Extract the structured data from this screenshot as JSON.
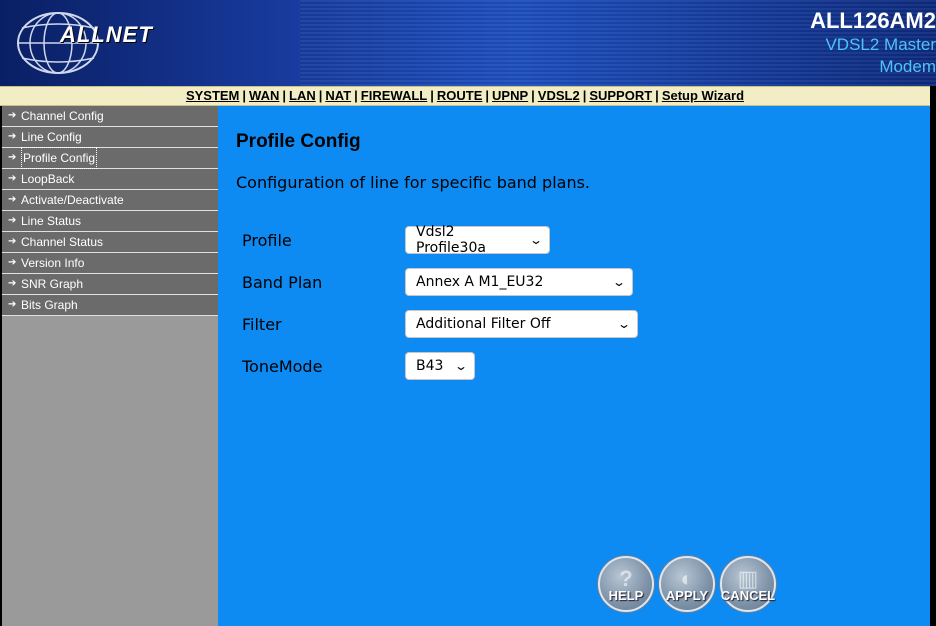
{
  "header": {
    "logo_text": "ALLNET",
    "model_name": "ALL126AM2",
    "model_sub_line1": "VDSL2 Master",
    "model_sub_line2": "Modem"
  },
  "nav": {
    "items": [
      "SYSTEM",
      "WAN",
      "LAN",
      "NAT",
      "FIREWALL",
      "ROUTE",
      "UPNP",
      "VDSL2",
      "SUPPORT",
      "Setup Wizard"
    ]
  },
  "sidebar": {
    "items": [
      {
        "label": "Channel Config"
      },
      {
        "label": "Line Config"
      },
      {
        "label": "Profile Config"
      },
      {
        "label": "LoopBack"
      },
      {
        "label": "Activate/Deactivate"
      },
      {
        "label": "Line Status"
      },
      {
        "label": "Channel Status"
      },
      {
        "label": "Version Info"
      },
      {
        "label": "SNR Graph"
      },
      {
        "label": "Bits Graph"
      }
    ],
    "active_index": 2
  },
  "main": {
    "title": "Profile Config",
    "description": "Configuration of line for specific band plans.",
    "fields": [
      {
        "label": "Profile",
        "value": "Vdsl2 Profile30a"
      },
      {
        "label": "Band Plan",
        "value": "Annex A M1_EU32"
      },
      {
        "label": "Filter",
        "value": "Additional Filter Off"
      },
      {
        "label": "ToneMode",
        "value": "B43"
      }
    ]
  },
  "buttons": {
    "help": "HELP",
    "apply": "APPLY",
    "cancel": "CANCEL"
  },
  "colors": {
    "main_bg": "#0d8bf2",
    "sidebar_item_bg": "#6b6b6b",
    "sidebar_bg": "#9a9a9a",
    "nav_bg": "#f2edc4",
    "model_sub": "#4fc3f7"
  }
}
